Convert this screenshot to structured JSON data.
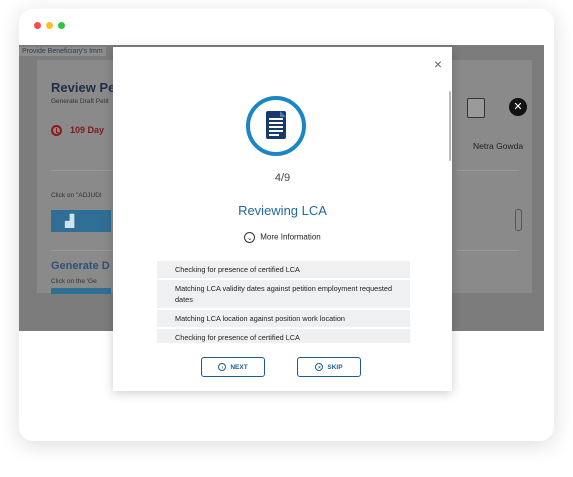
{
  "app": {
    "topbar_text": "Provide Beneficiary's Imm",
    "background_card": {
      "title": "Review Peti",
      "subtitle": "Generate Draft Petit",
      "days_label": "109 Day",
      "click_text": "Click on \"ADJUDI",
      "section_title": "Generate D",
      "click_text_2": "Click on the 'Ge",
      "user_name": "Netra Gowda"
    }
  },
  "modal": {
    "step_counter": "4/9",
    "heading": "Reviewing LCA",
    "more_info": "More Information",
    "checks": [
      "Checking for presence of certified LCA",
      "Matching LCA validity dates against petition employment requested dates",
      "Matching LCA location against position work location",
      "Checking for presence of certified LCA"
    ],
    "next_label": "NEXT",
    "skip_label": "SKIP",
    "close_symbol": "×"
  },
  "colors": {
    "accent": "#1e6a9e",
    "ring": "#1a86c4",
    "button_border": "#1e5c8a",
    "overlay": "#7c7c7c"
  },
  "icons": [
    "close-icon",
    "document-icon",
    "chevron-down-icon",
    "next-icon",
    "skip-icon",
    "clock-icon",
    "clipboard-icon",
    "chart-icon"
  ]
}
